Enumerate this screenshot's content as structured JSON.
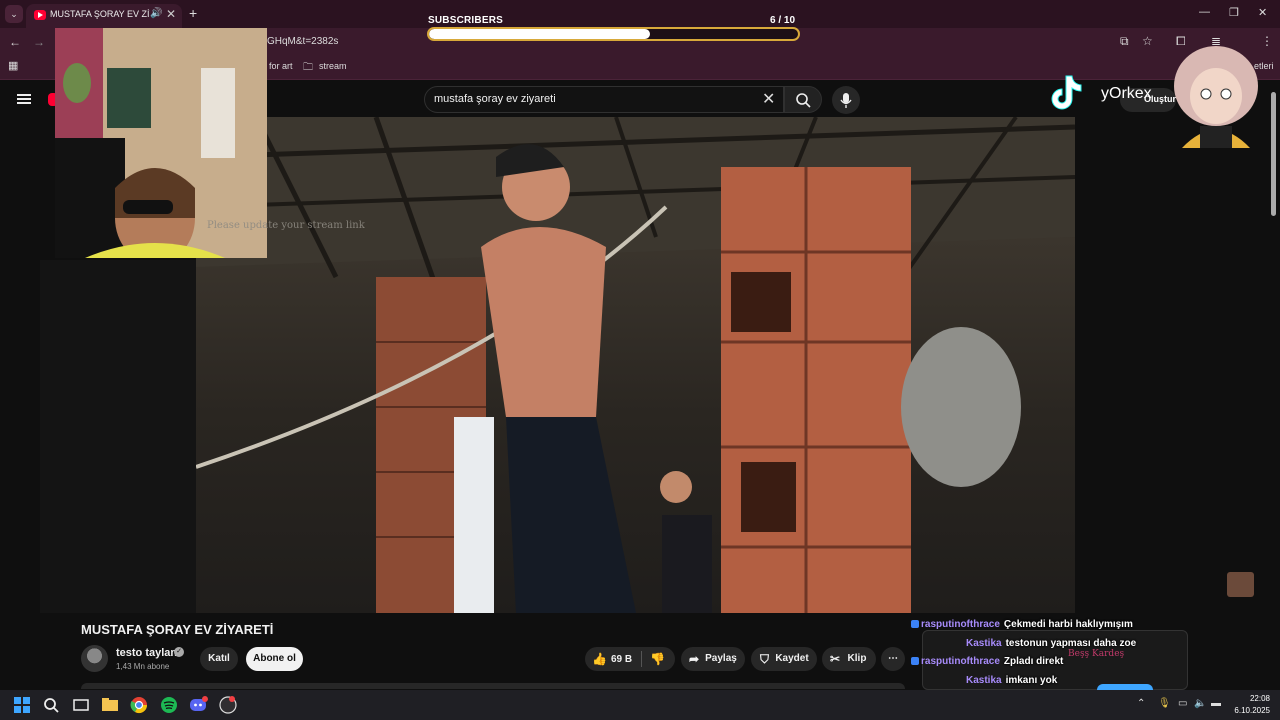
{
  "browser": {
    "tab_title": "MUSTAFA ŞORAY EV ZİYARE",
    "url_fragment": "GHqM&t=2382s",
    "bookmarks": [
      "for art",
      "stream"
    ],
    "bookmark_more": "etleri"
  },
  "overlay": {
    "subscribers_label": "SUBSCRIBERS",
    "subscribers_progress": "6  / 10",
    "subscribers_fraction": 0.6,
    "stream_message": "Please update your stream link",
    "tiktok_handle": "yOrkex"
  },
  "youtube": {
    "search_query": "mustafa şoray ev ziyareti",
    "create_label": "Oluştur",
    "video_title": "MUSTAFA ŞORAY EV ZİYARETİ",
    "channel_name": "testo taylan",
    "channel_subscribers": "1,43 Mn abone",
    "join_label": "Katıl",
    "subscribe_label": "Abone ol",
    "like_count": "69 B",
    "share_label": "Paylaş",
    "save_label": "Kaydet",
    "clip_label": "Klip"
  },
  "chat": [
    {
      "user": "rasputinofthrace",
      "message": "Çekmedi harbi haklıymışım"
    },
    {
      "user": "Kastika",
      "message": "testonun yapması daha zoe"
    },
    {
      "user": "rasputinofthrace",
      "message": "Zpladı direkt"
    },
    {
      "user": "Kastika",
      "message": "imkanı yok"
    }
  ],
  "chat_ghost_text": "Beşş Kardeş",
  "taskbar": {
    "time": "22:08",
    "date": "6.10.2025"
  },
  "colors": {
    "browser_frame": "#2b1220",
    "accent_gold": "#d8a93a",
    "youtube_red": "#ff0033",
    "chat_name": "#a78bfa"
  }
}
